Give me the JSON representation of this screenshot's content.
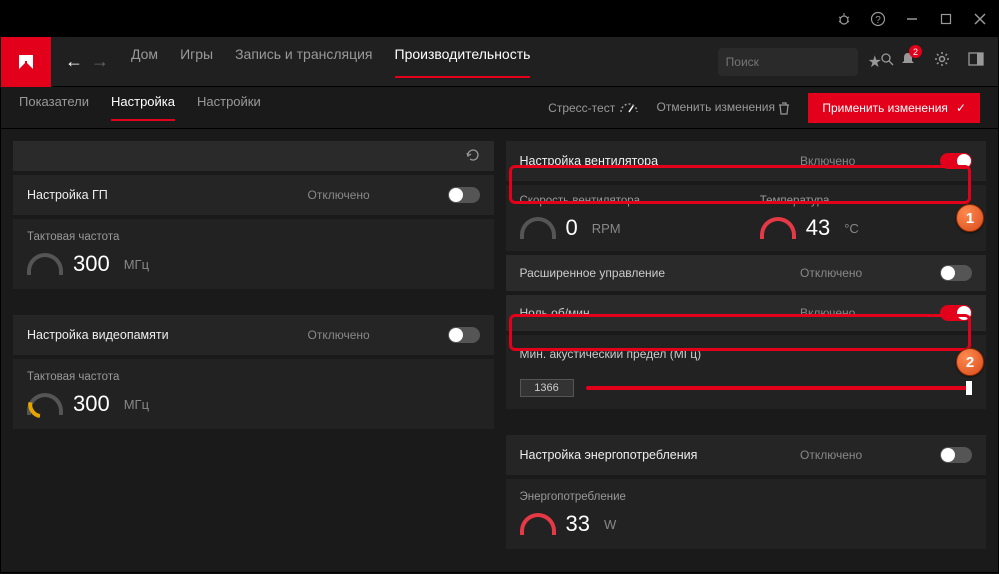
{
  "titlebar": {
    "bug": "⚙",
    "help": "?"
  },
  "topnav": {
    "items": [
      "Дом",
      "Игры",
      "Запись и трансляция",
      "Производительность"
    ],
    "active": 3
  },
  "search": {
    "placeholder": "Поиск"
  },
  "bell_badge": "2",
  "subtabs": {
    "items": [
      "Показатели",
      "Настройка",
      "Настройки"
    ],
    "active": 1
  },
  "subactions": {
    "stress": "Стресс-тест",
    "revert": "Отменить изменения",
    "apply": "Применить изменения"
  },
  "left": {
    "gpu": {
      "title": "Настройка ГП",
      "state": "Отключено"
    },
    "clock": {
      "label": "Тактовая частота",
      "value": "300",
      "unit": "МГц"
    },
    "vram": {
      "title": "Настройка видеопамяти",
      "state": "Отключено"
    },
    "vclock": {
      "label": "Тактовая частота",
      "value": "300",
      "unit": "МГц"
    }
  },
  "right": {
    "fan": {
      "title": "Настройка вентилятора",
      "state": "Включено"
    },
    "speed": {
      "label": "Скорость вентилятора",
      "value": "0",
      "unit": "RPM"
    },
    "temp": {
      "label": "Температура",
      "value": "43",
      "unit": "°C"
    },
    "advanced": {
      "label": "Расширенное управление",
      "state": "Отключено"
    },
    "zerorpm": {
      "label": "Ноль об/мин",
      "state": "Включено"
    },
    "acoustic": {
      "label": "Мин. акустический предел (МГц)",
      "value": "1366"
    },
    "power": {
      "title": "Настройка энергопотребления",
      "state": "Отключено"
    },
    "powerval": {
      "label": "Энергопотребление",
      "value": "33",
      "unit": "W"
    }
  },
  "badges": {
    "b1": "1",
    "b2": "2"
  }
}
